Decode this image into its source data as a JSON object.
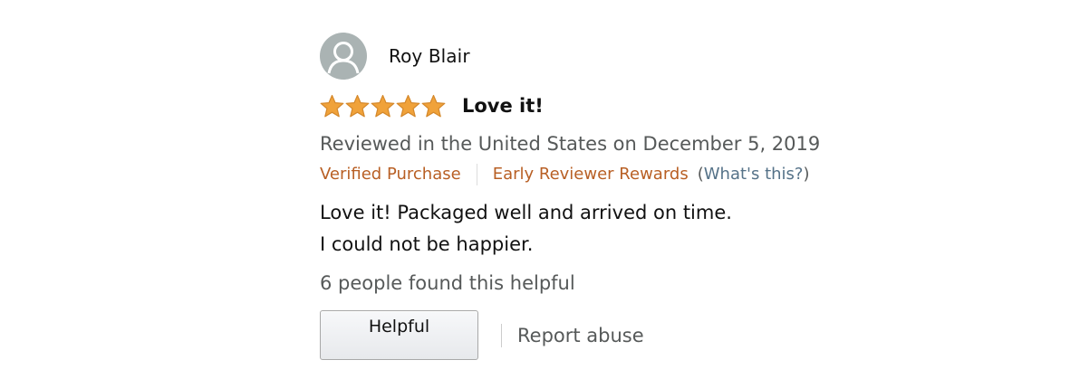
{
  "review": {
    "reviewer_name": "Roy Blair",
    "avatar_icon": "user-silhouette-icon",
    "rating": 5,
    "rating_max": 5,
    "star_color": "#f0a23a",
    "title": "Love it!",
    "date_text": "Reviewed in the United States on December 5, 2019",
    "badges": {
      "verified": "Verified Purchase",
      "early_reviewer": "Early Reviewer Rewards",
      "whats_this_open": "(",
      "whats_this_link": "What's this?",
      "whats_this_close": ")"
    },
    "body_lines": [
      "Love it! Packaged well and arrived on time.",
      "I could not be happier."
    ],
    "helpful_count_text": "6 people found this helpful",
    "helpful_button_label": "Helpful",
    "report_abuse_label": "Report abuse"
  },
  "colors": {
    "badge_orange": "#b85f24",
    "link_blue": "#557288",
    "secondary_text": "#565959"
  }
}
